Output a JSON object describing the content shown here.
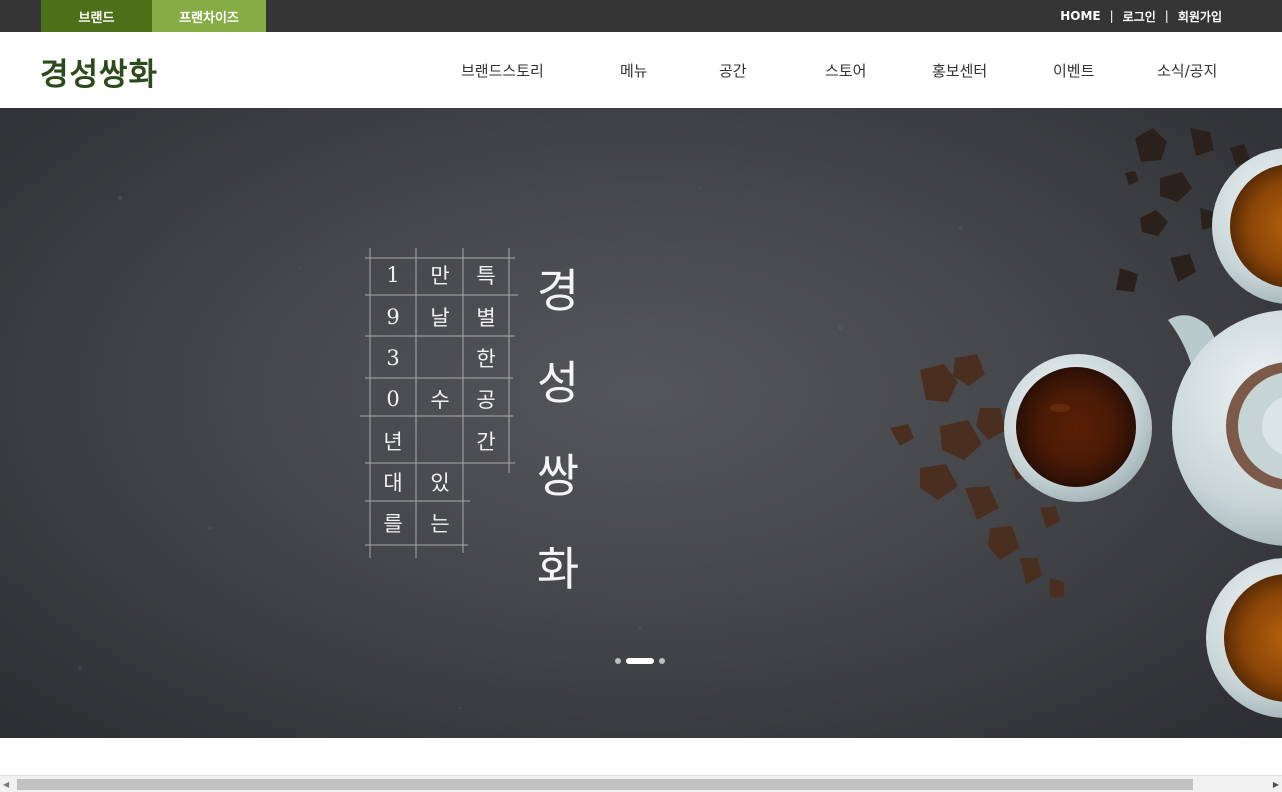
{
  "topbar": {
    "brand_tab": "브랜드",
    "franchise_tab": "프랜차이즈",
    "home": "HOME",
    "login": "로그인",
    "signup": "회원가입",
    "separator": "|"
  },
  "header": {
    "logo": "경성쌍화",
    "nav": [
      "브랜드스토리",
      "메뉴",
      "공간",
      "스토어",
      "홍보센터",
      "이벤트",
      "소식/공지"
    ]
  },
  "hero": {
    "grid_columns": [
      [
        "1",
        "9",
        "3",
        "0",
        "년",
        "대",
        "를"
      ],
      [
        "만",
        "날",
        "",
        "수",
        "",
        "있",
        "는"
      ],
      [
        "특",
        "별",
        "한",
        "공",
        "간",
        "",
        ""
      ]
    ],
    "title_chars": [
      "경",
      "성",
      "쌍",
      "화"
    ],
    "slider": {
      "total": 3,
      "active_index": 1
    }
  },
  "colors": {
    "brand_tab": "#4c7018",
    "franchise_tab": "#86ac46",
    "topbar_bg": "#353535",
    "logo": "#2c4a1a"
  }
}
